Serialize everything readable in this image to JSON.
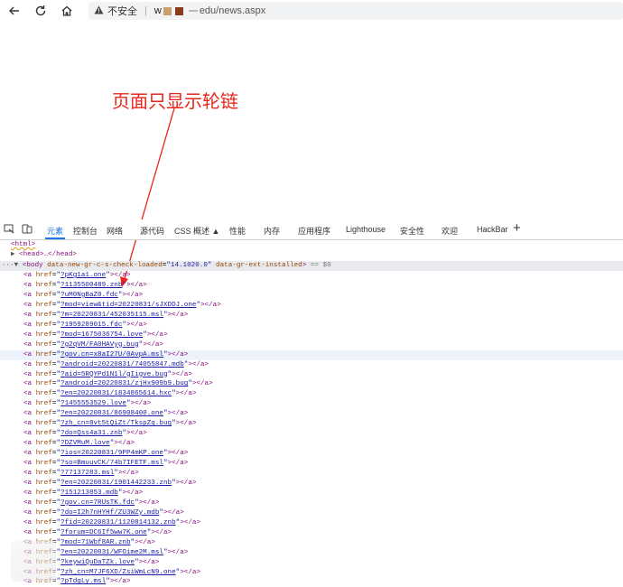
{
  "browser": {
    "security_label": "不安全",
    "url_prefix": "w",
    "url_suffix": "edu/news.aspx"
  },
  "annotation": {
    "text": "页面只显示轮链",
    "color": "#e8261b"
  },
  "devtools": {
    "tabs": [
      {
        "label": "元素",
        "active": true
      },
      {
        "label": "控制台"
      },
      {
        "label": "网络"
      },
      {
        "label": "源代码"
      },
      {
        "label": "CSS 概述 ▲"
      },
      {
        "label": "性能"
      },
      {
        "label": "内存"
      },
      {
        "label": "应用程序"
      },
      {
        "label": "Lighthouse"
      },
      {
        "label": "安全性"
      },
      {
        "label": "欢迎"
      },
      {
        "label": "HackBar"
      },
      {
        "label": "+"
      }
    ],
    "html_open": "<html>",
    "head_line": "<head>…</head>",
    "body_line": {
      "tag_open": "<body",
      "attr1_name": "data-new-gr-c-s-check-loaded",
      "attr1_value": "14.1020.0",
      "attr2_name": "data-gr-ext-installed",
      "suffix": ">",
      "equals": "== $0"
    },
    "links": [
      "?pKg1a1.one",
      "?1135500489.znb",
      "?uM0NgBaZ0.fdc",
      "?mod=view&tid=20220831/sJXDDJ.one",
      "?m=20220831/452035115.msl",
      "?1959289015.fdc",
      "?mod=1675036754.love",
      "?g2qVM/FA0HAVyg.bug",
      "?gov.cn=x8aI27U/0AvpA.msl",
      "?android=20220831/74055847.mdb",
      "?aid=5RQYPd1N1l/gIigve.bug",
      "?android=20220831/zjHx909b9.bug",
      "?en=20220831/1834865614.hxc",
      "?1455553529.love",
      "?en=20220831/86908400.one",
      "?zh_cn=8vt5tQiZt/TkspZq.bug",
      "?do=Qss4a31.znb",
      "?DZVMuM.love",
      "?ios=20220831/9PP4mKP.one",
      "?so=BmuuvCK/74b7IFETF.msl",
      "?77137283.msl",
      "?en=20220831/1901442233.znb",
      "?151213853.mdb",
      "?gov.cn=7RUsTK.fdc",
      "?do=I2h7nHYHf/ZU3WZy.mdb",
      "?fid=20220831/1120814132.znb",
      "?forum=DC6If5ww7K.one",
      "?mod=71Wbf8AR.znb",
      "?en=20220831/WFOime2M.msl",
      "?keywiQuDaTZk.love",
      "?zh_cn=M7JF6XD/ZsiWmLcN9.one",
      "?pTdgLy.msl"
    ]
  }
}
